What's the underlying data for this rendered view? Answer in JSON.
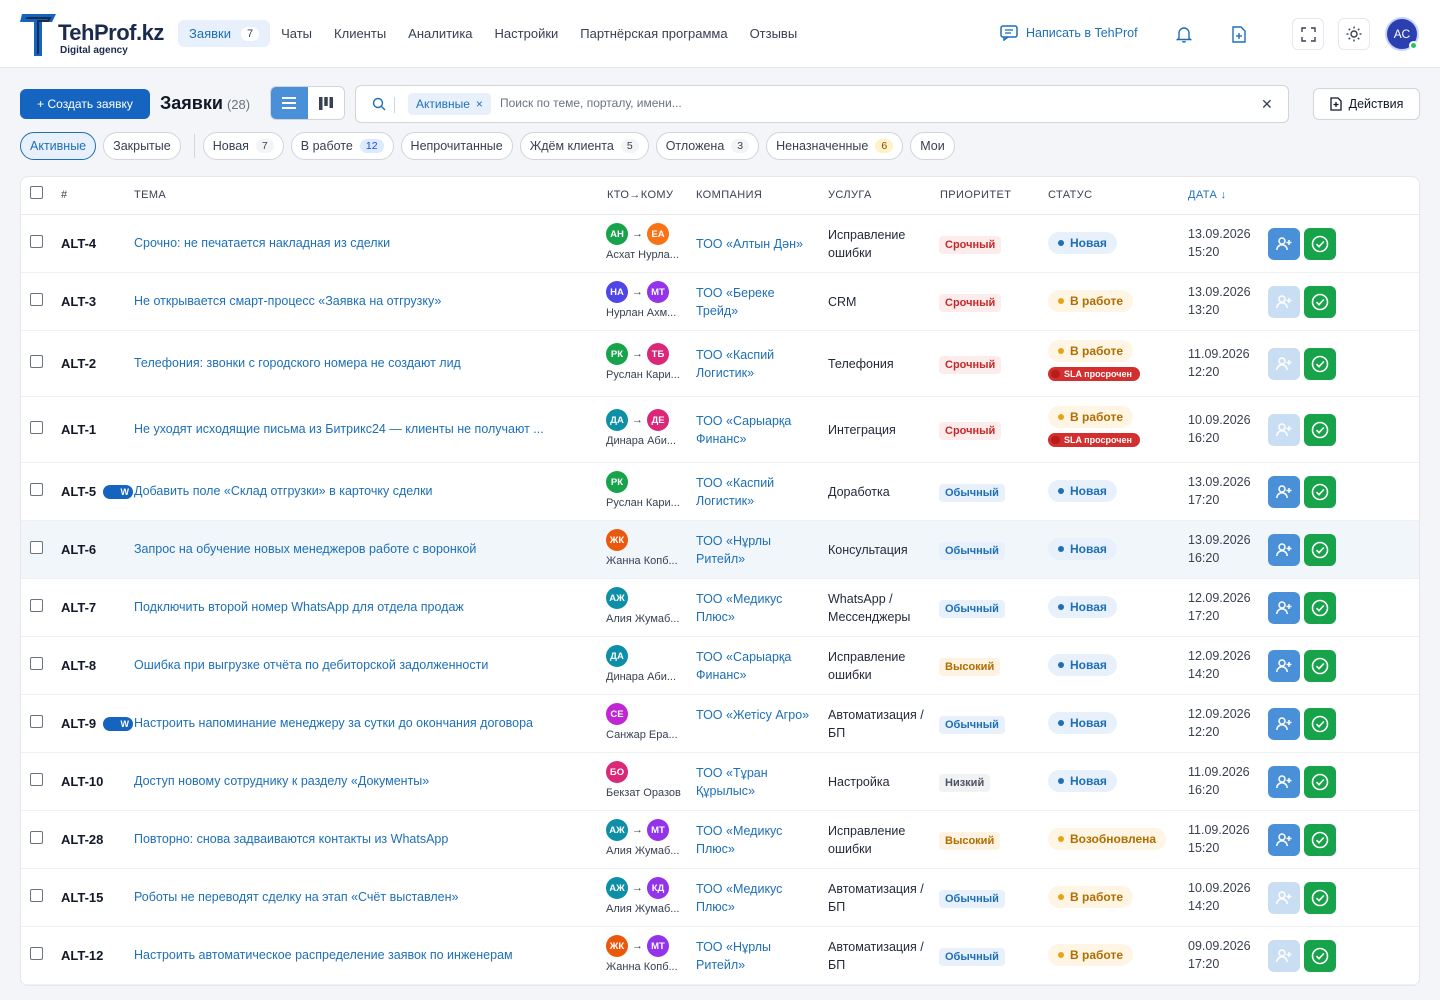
{
  "brand": {
    "name": "TehProf.kz",
    "tagline": "Digital agency"
  },
  "nav": {
    "items": [
      {
        "label": "Заявки",
        "badge": "7",
        "active": true
      },
      {
        "label": "Чаты"
      },
      {
        "label": "Клиенты"
      },
      {
        "label": "Аналитика"
      },
      {
        "label": "Настройки"
      },
      {
        "label": "Партнёрская программа"
      },
      {
        "label": "Отзывы"
      }
    ],
    "write_label": "Написать в TehProf",
    "icons": [
      "bell-icon",
      "file-plus-icon",
      "fullscreen-icon",
      "sun-icon"
    ],
    "avatar_initials": "АС"
  },
  "toolbar": {
    "create_label": "+ Создать заявку",
    "title": "Заявки",
    "count": "(28)",
    "filter_chip": "Активные",
    "search_placeholder": "Поиск по теме, порталу, имени...",
    "actions_label": "Действия"
  },
  "tabs": [
    {
      "label": "Активные",
      "active": true
    },
    {
      "label": "Закрытые"
    },
    {
      "label": "Новая",
      "badge": "7"
    },
    {
      "label": "В работе",
      "badge": "12",
      "badge_color": "blue"
    },
    {
      "label": "Непрочитанные"
    },
    {
      "label": "Ждём клиента",
      "badge": "5"
    },
    {
      "label": "Отложена",
      "badge": "3"
    },
    {
      "label": "Неназначенные",
      "badge": "6",
      "badge_color": "yellow"
    },
    {
      "label": "Мои"
    }
  ],
  "columns": {
    "num": "#",
    "subject": "ТЕМА",
    "who": "КТО→КОМУ",
    "company": "КОМПАНИЯ",
    "service": "УСЛУГА",
    "priority": "ПРИОРИТЕТ",
    "status": "СТАТУС",
    "date": "ДАТА ↓"
  },
  "colors": {
    "accent": "#1d6fb8",
    "primary_button": "#1565c0",
    "done_button": "#16a34a",
    "urgent": "#c62828",
    "sla": "#d32f2f"
  },
  "rows": [
    {
      "id": "ALT-4",
      "subject": "Срочно: не печатается накладная из сделки",
      "from": "АН",
      "from_color": "#16a34a",
      "to": "ЕА",
      "to_color": "#f97316",
      "who_name": "Асхат Нурла...",
      "company": "ТОО «Алтын Дән»",
      "service": "Исправление ошибки",
      "priority": "Срочный",
      "prio": "urgent",
      "status": "Новая",
      "st": "new",
      "date": "13.09.2026",
      "time": "15:20"
    },
    {
      "id": "ALT-3",
      "subject": "Не открывается смарт-процесс «Заявка на отгрузку»",
      "from": "НА",
      "from_color": "#4f46e5",
      "to": "МТ",
      "to_color": "#9333ea",
      "who_name": "Нурлан Ахм...",
      "company": "ТОО «Береке Трейд»",
      "service": "CRM",
      "priority": "Срочный",
      "prio": "urgent",
      "status": "В работе",
      "st": "work",
      "date": "13.09.2026",
      "time": "13:20",
      "assign_disabled": true
    },
    {
      "id": "ALT-2",
      "subject": "Телефония: звонки с городского номера не создают лид",
      "from": "РК",
      "from_color": "#16a34a",
      "to": "ТБ",
      "to_color": "#db2777",
      "who_name": "Руслан Кари...",
      "company": "ТОО «Каспий Логистик»",
      "service": "Телефония",
      "priority": "Срочный",
      "prio": "urgent",
      "status": "В работе",
      "st": "work",
      "sla": "SLA просрочен",
      "date": "11.09.2026",
      "time": "12:20",
      "assign_disabled": true
    },
    {
      "id": "ALT-1",
      "subject": "Не уходят исходящие письма из Битрикс24 — клиенты не получают ...",
      "from": "ДА",
      "from_color": "#0e8fa8",
      "to": "ДЕ",
      "to_color": "#db2777",
      "who_name": "Динара Аби...",
      "company": "ТОО «Сарыарқа Финанс»",
      "service": "Интеграция",
      "priority": "Срочный",
      "prio": "urgent",
      "status": "В работе",
      "st": "work",
      "sla": "SLA просрочен",
      "date": "10.09.2026",
      "time": "16:20",
      "assign_disabled": true
    },
    {
      "id": "ALT-5",
      "w": "W",
      "subject": "Добавить поле «Склад отгрузки» в карточку сделки",
      "from": "РК",
      "from_color": "#16a34a",
      "who_name": "Руслан Кари...",
      "company": "ТОО «Каспий Логистик»",
      "service": "Доработка",
      "priority": "Обычный",
      "prio": "normal",
      "status": "Новая",
      "st": "new",
      "date": "13.09.2026",
      "time": "17:20"
    },
    {
      "id": "ALT-6",
      "subject": "Запрос на обучение новых менеджеров работе с воронкой",
      "from": "ЖК",
      "from_color": "#ea580c",
      "who_name": "Жанна Копб...",
      "company": "ТОО «Нұрлы Ритейл»",
      "service": "Консультация",
      "priority": "Обычный",
      "prio": "normal",
      "status": "Новая",
      "st": "new",
      "date": "13.09.2026",
      "time": "16:20",
      "hl": true
    },
    {
      "id": "ALT-7",
      "subject": "Подключить второй номер WhatsApp для отдела продаж",
      "from": "АЖ",
      "from_color": "#0e8fa8",
      "who_name": "Алия Жумаб...",
      "company": "ТОО «Медикус Плюс»",
      "service": "WhatsApp / Мессенджеры",
      "priority": "Обычный",
      "prio": "normal",
      "status": "Новая",
      "st": "new",
      "date": "12.09.2026",
      "time": "17:20"
    },
    {
      "id": "ALT-8",
      "subject": "Ошибка при выгрузке отчёта по дебиторской задолженности",
      "from": "ДА",
      "from_color": "#0e8fa8",
      "who_name": "Динара Аби...",
      "company": "ТОО «Сарыарқа Финанс»",
      "service": "Исправление ошибки",
      "priority": "Высокий",
      "prio": "high",
      "status": "Новая",
      "st": "new",
      "date": "12.09.2026",
      "time": "14:20"
    },
    {
      "id": "ALT-9",
      "w": "W",
      "subject": "Настроить напоминание менеджеру за сутки до окончания договора",
      "from": "СЕ",
      "from_color": "#c026d3",
      "who_name": "Санжар Ера...",
      "company": "ТОО «Жетісу Агро»",
      "service": "Автоматизация / БП",
      "priority": "Обычный",
      "prio": "normal",
      "status": "Новая",
      "st": "new",
      "date": "12.09.2026",
      "time": "12:20"
    },
    {
      "id": "ALT-10",
      "subject": "Доступ новому сотруднику к разделу «Документы»",
      "from": "БО",
      "from_color": "#db2777",
      "who_name": "Бекзат Оразов",
      "company": "ТОО «Тұран Құрылыс»",
      "service": "Настройка",
      "priority": "Низкий",
      "prio": "low",
      "status": "Новая",
      "st": "new",
      "date": "11.09.2026",
      "time": "16:20"
    },
    {
      "id": "ALT-28",
      "subject": "Повторно: снова задваиваются контакты из WhatsApp",
      "from": "АЖ",
      "from_color": "#0e8fa8",
      "to": "МТ",
      "to_color": "#9333ea",
      "who_name": "Алия Жумаб...",
      "company": "ТОО «Медикус Плюс»",
      "service": "Исправление ошибки",
      "priority": "Высокий",
      "prio": "high",
      "status": "Возобновлена",
      "st": "work",
      "date": "11.09.2026",
      "time": "15:20"
    },
    {
      "id": "ALT-15",
      "subject": "Роботы не переводят сделку на этап «Счёт выставлен»",
      "from": "АЖ",
      "from_color": "#0e8fa8",
      "to": "КД",
      "to_color": "#9333ea",
      "who_name": "Алия Жумаб...",
      "company": "ТОО «Медикус Плюс»",
      "service": "Автоматизация / БП",
      "priority": "Обычный",
      "prio": "normal",
      "status": "В работе",
      "st": "work",
      "date": "10.09.2026",
      "time": "14:20",
      "assign_disabled": true
    },
    {
      "id": "ALT-12",
      "subject": "Настроить автоматическое распределение заявок по инженерам",
      "from": "ЖК",
      "from_color": "#ea580c",
      "to": "МТ",
      "to_color": "#9333ea",
      "who_name": "Жанна Копб...",
      "company": "ТОО «Нұрлы Ритейл»",
      "service": "Автоматизация / БП",
      "priority": "Обычный",
      "prio": "normal",
      "status": "В работе",
      "st": "work",
      "date": "09.09.2026",
      "time": "17:20",
      "assign_disabled": true
    }
  ]
}
